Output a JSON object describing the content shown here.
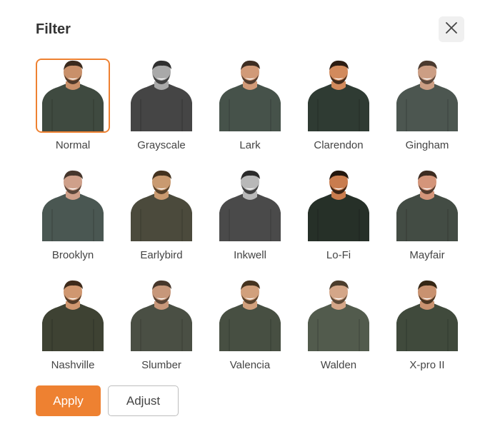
{
  "dialog": {
    "title": "Filter",
    "close_icon": "close-icon"
  },
  "filters": [
    {
      "label": "Normal",
      "selected": true
    },
    {
      "label": "Grayscale",
      "selected": false
    },
    {
      "label": "Lark",
      "selected": false
    },
    {
      "label": "Clarendon",
      "selected": false
    },
    {
      "label": "Gingham",
      "selected": false
    },
    {
      "label": "Brooklyn",
      "selected": false
    },
    {
      "label": "Earlybird",
      "selected": false
    },
    {
      "label": "Inkwell",
      "selected": false
    },
    {
      "label": "Lo-Fi",
      "selected": false
    },
    {
      "label": "Mayfair",
      "selected": false
    },
    {
      "label": "Nashville",
      "selected": false
    },
    {
      "label": "Slumber",
      "selected": false
    },
    {
      "label": "Valencia",
      "selected": false
    },
    {
      "label": "Walden",
      "selected": false
    },
    {
      "label": "X-pro II",
      "selected": false
    }
  ],
  "buttons": {
    "apply_label": "Apply",
    "adjust_label": "Adjust"
  },
  "colors": {
    "accent": "#ee8131"
  }
}
